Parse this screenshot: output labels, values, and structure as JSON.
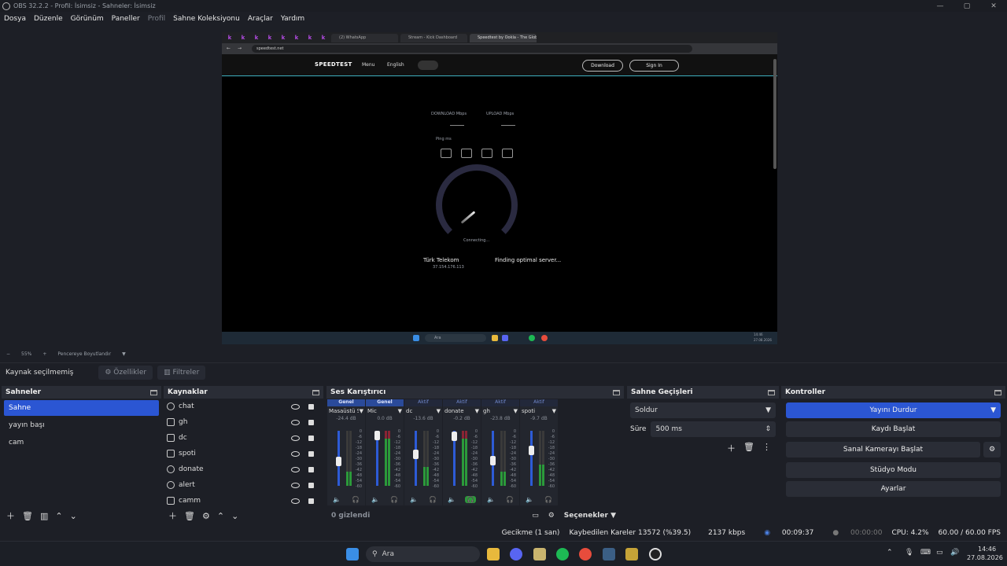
{
  "window": {
    "title": "OBS 32.2.2 - Profil: İsimsiz - Sahneler: İsimsiz",
    "minimize": "—",
    "maximize": "▢",
    "close": "✕"
  },
  "menu": [
    "Dosya",
    "Düzenle",
    "Görünüm",
    "Paneller",
    "Profil",
    "Sahne Koleksiyonu",
    "Araçlar",
    "Yardım"
  ],
  "browser": {
    "tabs": [
      "(2) WhatsApp",
      "Stream - Kick Dashboard",
      "Speedtest by Ookla - The Glob…"
    ],
    "url": "speedtest.net",
    "speedtest": {
      "logo": "SPEEDTEST",
      "menu": "Menu",
      "language": "English",
      "download_btn": "Download",
      "signin_btn": "Sign In",
      "download_label": "DOWNLOAD Mbps",
      "upload_label": "UPLOAD Mbps",
      "ping_label": "Ping ms",
      "connecting": "Connecting...",
      "isp": "Türk Telekom",
      "ip": "37.154.176.113",
      "server_status": "Finding optimal server..."
    },
    "taskbar_search": "Ara",
    "clock_time": "14:46",
    "clock_date": "27.08.2026"
  },
  "zoombar": {
    "minus": "−",
    "zoom": "55%",
    "plus": "+",
    "resize": "Pencereye Boyutlandır"
  },
  "source_bar": {
    "label": "Kaynak seçilmemiş",
    "properties": "Özellikler",
    "filters": "Filtreler"
  },
  "scenes": {
    "title": "Sahneler",
    "items": [
      "Sahne",
      "yayın başı",
      "cam"
    ]
  },
  "sources": {
    "title": "Kaynaklar",
    "items": [
      "chat",
      "gh",
      "dc",
      "spoti",
      "donate",
      "alert",
      "camm"
    ]
  },
  "mixer": {
    "title": "Ses Karıştırıcı",
    "strips": [
      {
        "cat": "Genel",
        "name": "Masaüstü Ses",
        "db": "-24.4 dB",
        "level": 0.45
      },
      {
        "cat": "Genel",
        "name": "Mic",
        "db": "0.0 dB",
        "level": 1.0
      },
      {
        "cat": "Aktif",
        "name": "dc",
        "db": "-13.6 dB",
        "level": 0.6
      },
      {
        "cat": "Aktif",
        "name": "donate",
        "db": "-0.2 dB",
        "level": 0.98
      },
      {
        "cat": "Aktif",
        "name": "gh",
        "db": "-23.8 dB",
        "level": 0.46
      },
      {
        "cat": "Aktif",
        "name": "spoti",
        "db": "-9.7 dB",
        "level": 0.68
      }
    ],
    "scale": [
      "0",
      "-6",
      "-12",
      "-18",
      "-24",
      "-30",
      "-36",
      "-42",
      "-48",
      "-54",
      "-60"
    ],
    "hidden": "0 gizlendi",
    "options": "Seçenekler"
  },
  "transitions": {
    "title": "Sahne Geçişleri",
    "type": "Soldur",
    "duration_label": "Süre",
    "duration": "500 ms"
  },
  "controls": {
    "title": "Kontroller",
    "stop_stream": "Yayını Durdur",
    "start_record": "Kaydı Başlat",
    "virtual_cam": "Sanal Kamerayı Başlat",
    "studio": "Stüdyo Modu",
    "settings": "Ayarlar"
  },
  "status": {
    "delay": "Gecikme (1 san)",
    "dropped": "Kaybedilen Kareler 13572 (%39.5)",
    "bitrate": "2137 kbps",
    "stream_time": "00:09:37",
    "record_time": "00:00:00",
    "cpu": "CPU: 4.2%",
    "fps": "60.00 / 60.00 FPS"
  },
  "taskbar": {
    "search": "Ara",
    "time": "14:46",
    "date": "27.08.2026"
  },
  "colors": {
    "accent": "#2b56d3",
    "meter_green": "#2b9a3a",
    "meter_red": "#8a2434",
    "muted_red": "#c0303a"
  }
}
